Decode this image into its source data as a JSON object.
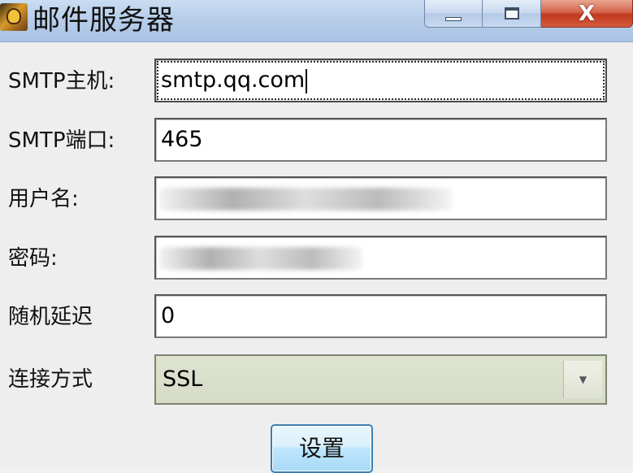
{
  "window": {
    "title": "邮件服务器",
    "min_icon": "minimize-icon",
    "max_icon": "maximize-icon",
    "close_icon": "close-icon",
    "close_glyph": "X"
  },
  "form": {
    "smtp_host": {
      "label": "SMTP主机:",
      "value": "smtp.qq.com"
    },
    "smtp_port": {
      "label": "SMTP端口:",
      "value": "465"
    },
    "username": {
      "label": "用户名:",
      "value": ""
    },
    "password": {
      "label": "密码:",
      "value": ""
    },
    "random_delay": {
      "label": "随机延迟",
      "value": "0"
    },
    "connection": {
      "label": "连接方式",
      "selected": "SSL"
    }
  },
  "actions": {
    "set_label": "设置"
  }
}
